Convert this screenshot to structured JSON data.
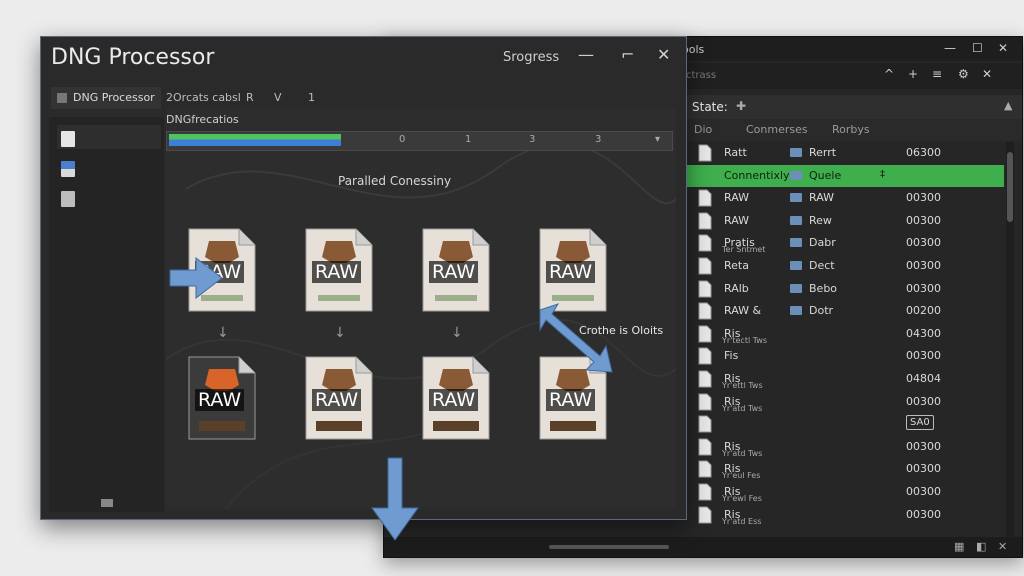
{
  "back_window": {
    "title": "ools",
    "controls": {
      "minimize": "—",
      "maximize": "☐",
      "close": "✕"
    },
    "toolbar": {
      "placeholder": "ctrass",
      "icons": [
        "chevron-up-icon",
        "plus-icon",
        "filter-icon",
        "gear-icon",
        "close-icon"
      ],
      "glyphs": [
        "^",
        "+",
        "≡",
        "⚙",
        "✕"
      ]
    },
    "panel": {
      "label": "State:",
      "pin_glyph": "✚",
      "more_glyph": "▲"
    },
    "columns": [
      "Dio",
      "Conmerses",
      "Rorbys"
    ],
    "rows": [
      {
        "name": "Ratt",
        "folder": "Rerrt",
        "value": "06300",
        "selected": false
      },
      {
        "name": "Connentixly",
        "folder": "Quele",
        "value": "",
        "selected": true,
        "stepper": "‡"
      },
      {
        "name": "RAW",
        "folder": "RAW",
        "value": "00300",
        "selected": false
      },
      {
        "name": "RAW",
        "folder": "Rew",
        "value": "00300",
        "selected": false
      },
      {
        "name": "Pratis",
        "sub": "Ter Sntmet",
        "folder": "Dabr",
        "value": "00300",
        "selected": false
      },
      {
        "name": "Reta",
        "folder": "Dect",
        "value": "00300",
        "selected": false
      },
      {
        "name": "RAlb",
        "folder": "Bebo",
        "value": "00300",
        "selected": false
      },
      {
        "name": "RAW &",
        "folder": "Dotr",
        "value": "00200",
        "selected": false
      },
      {
        "name": "Ris",
        "sub": "Yr'tectl Tws",
        "folder": "",
        "value": "04300",
        "selected": false
      },
      {
        "name": "Fis",
        "sub": "",
        "folder": "",
        "value": "00300",
        "selected": false
      },
      {
        "name": "Ris",
        "sub": "Yr'ettl Tws",
        "folder": "",
        "value": "04804",
        "selected": false
      },
      {
        "name": "Ris",
        "sub": "Yr'atd Tws",
        "folder": "",
        "value": "00300",
        "selected": false
      },
      {
        "name": "",
        "sub": "",
        "folder": "",
        "value": "",
        "badge": "SA0",
        "selected": false
      },
      {
        "name": "Ris",
        "sub": "Yr'atd Tws",
        "folder": "",
        "value": "00300",
        "selected": false
      },
      {
        "name": "Ris",
        "sub": "Yr'eul Fes",
        "folder": "",
        "value": "00300",
        "selected": false
      },
      {
        "name": "Ris",
        "sub": "Yr'ewl Fes",
        "folder": "",
        "value": "00300",
        "selected": false
      },
      {
        "name": "Ris",
        "sub": "Yr'atd Ess",
        "folder": "",
        "value": "00300",
        "selected": false
      }
    ],
    "status_icons": [
      "▦",
      "◧",
      "✕"
    ]
  },
  "front_window": {
    "title": "DNG Processor",
    "progress_title": "Srogress",
    "controls": {
      "minimize": "—",
      "maximize": "⌐",
      "close": "✕"
    },
    "app_tab": "DNG Processor",
    "tabs": [
      "2Orcats cabsl",
      "R",
      "V",
      "1"
    ],
    "progress_label": "DNGfrecatios",
    "progress": 0.34,
    "progress_ticks": [
      "0",
      "1",
      "3",
      "3"
    ],
    "progress_dropdown": "▾",
    "section_title": "Paralled Conessiny",
    "annotation": "Crothe is Oloits",
    "raw_label": "RAW",
    "arrow_down": "↓"
  },
  "colors": {
    "accent_green": "#3fae4d",
    "accent_blue": "#3d7fd6",
    "arrow_blue": "#6f9bd1"
  }
}
